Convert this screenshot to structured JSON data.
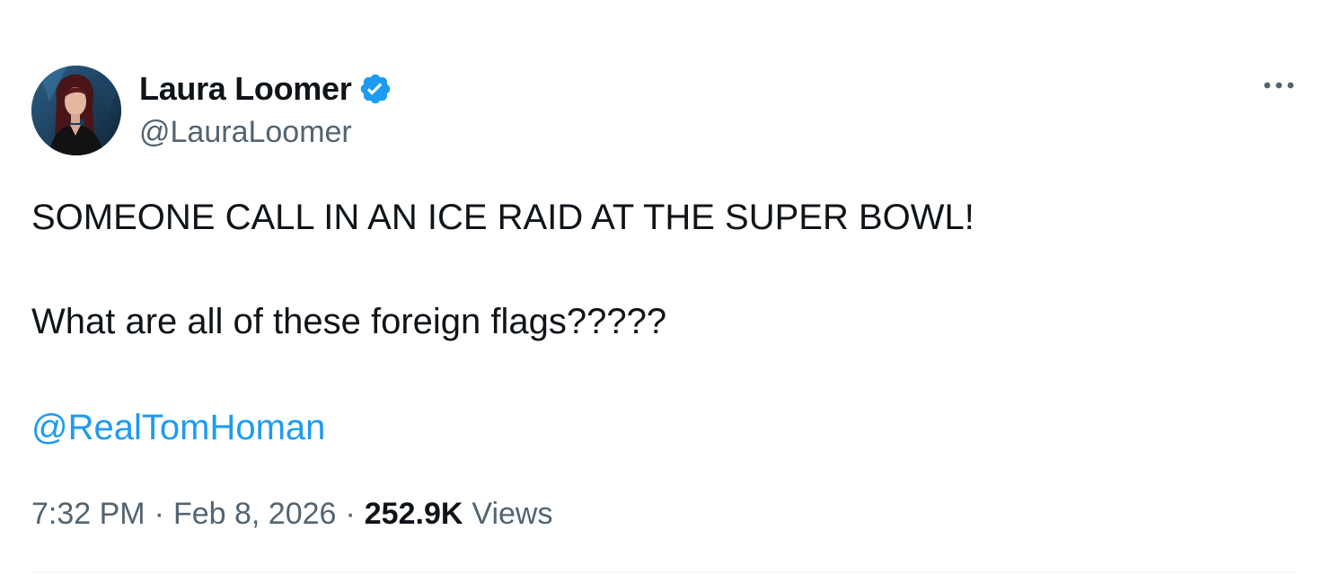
{
  "author": {
    "name": "Laura Loomer",
    "handle": "@LauraLoomer",
    "verified_badge_icon": "verified-badge-icon",
    "verified_color": "#1d9bf0"
  },
  "more_icon": "more-horizontal-icon",
  "tweet": {
    "line1": "SOMEONE CALL IN AN ICE RAID AT THE SUPER BOWL!",
    "line2": "What are all of these foreign flags?????",
    "mention": "@RealTomHoman"
  },
  "meta": {
    "time": "7:32 PM",
    "separator": "·",
    "date": "Feb 8, 2026",
    "views_count": "252.9K",
    "views_label": "Views"
  },
  "colors": {
    "text_primary": "#0f1419",
    "text_secondary": "#536471",
    "link": "#1d9bf0",
    "divider": "#eff3f4"
  }
}
